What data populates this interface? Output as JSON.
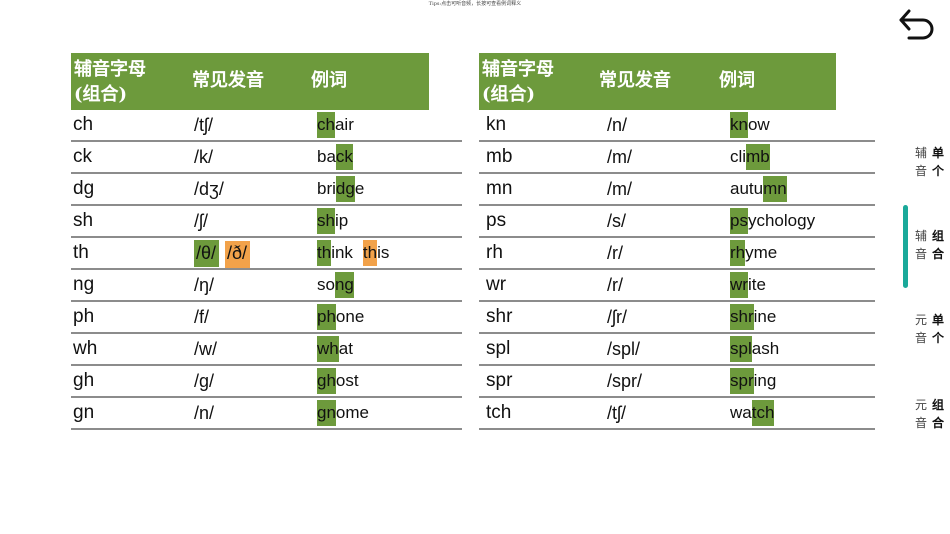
{
  "tip": "Tips:点击可听音频，长按可查看例词释义",
  "back_icon": "back-arrow-icon",
  "left_table": {
    "headers": [
      "辅音字母\n(组合)",
      "常见发音",
      "例词"
    ],
    "rows": [
      {
        "letters": "ch",
        "sounds": [
          {
            "text": "/tʃ/",
            "hl": ""
          }
        ],
        "examples": [
          {
            "parts": [
              {
                "t": "ch",
                "hl": "g"
              },
              {
                "t": "air",
                "hl": ""
              }
            ]
          }
        ]
      },
      {
        "letters": "ck",
        "sounds": [
          {
            "text": "/k/",
            "hl": ""
          }
        ],
        "examples": [
          {
            "parts": [
              {
                "t": "ba",
                "hl": ""
              },
              {
                "t": "ck",
                "hl": "g"
              }
            ]
          }
        ]
      },
      {
        "letters": "dg",
        "sounds": [
          {
            "text": "/dʒ/",
            "hl": ""
          }
        ],
        "examples": [
          {
            "parts": [
              {
                "t": "bri",
                "hl": ""
              },
              {
                "t": "dg",
                "hl": "g"
              },
              {
                "t": "e",
                "hl": ""
              }
            ]
          }
        ]
      },
      {
        "letters": "sh",
        "sounds": [
          {
            "text": "/ʃ/",
            "hl": ""
          }
        ],
        "examples": [
          {
            "parts": [
              {
                "t": "sh",
                "hl": "g"
              },
              {
                "t": "ip",
                "hl": ""
              }
            ]
          }
        ]
      },
      {
        "letters": "th",
        "sounds": [
          {
            "text": "/θ/",
            "hl": "g"
          },
          {
            "text": "/ð/",
            "hl": "o"
          }
        ],
        "examples": [
          {
            "parts": [
              {
                "t": "th",
                "hl": "g"
              },
              {
                "t": "ink",
                "hl": ""
              }
            ]
          },
          {
            "parts": [
              {
                "t": "th",
                "hl": "o"
              },
              {
                "t": "is",
                "hl": ""
              }
            ]
          }
        ]
      },
      {
        "letters": "ng",
        "sounds": [
          {
            "text": "/ŋ/",
            "hl": ""
          }
        ],
        "examples": [
          {
            "parts": [
              {
                "t": "so",
                "hl": ""
              },
              {
                "t": "ng",
                "hl": "g"
              }
            ]
          }
        ]
      },
      {
        "letters": "ph",
        "sounds": [
          {
            "text": "/f/",
            "hl": ""
          }
        ],
        "examples": [
          {
            "parts": [
              {
                "t": "ph",
                "hl": "g"
              },
              {
                "t": "one",
                "hl": ""
              }
            ]
          }
        ]
      },
      {
        "letters": "wh",
        "sounds": [
          {
            "text": "/w/",
            "hl": ""
          }
        ],
        "examples": [
          {
            "parts": [
              {
                "t": "wh",
                "hl": "g"
              },
              {
                "t": "at",
                "hl": ""
              }
            ]
          }
        ]
      },
      {
        "letters": "gh",
        "sounds": [
          {
            "text": "/g/",
            "hl": ""
          }
        ],
        "examples": [
          {
            "parts": [
              {
                "t": "gh",
                "hl": "g"
              },
              {
                "t": "ost",
                "hl": ""
              }
            ]
          }
        ]
      },
      {
        "letters": "gn",
        "sounds": [
          {
            "text": "/n/",
            "hl": ""
          }
        ],
        "examples": [
          {
            "parts": [
              {
                "t": "gn",
                "hl": "g"
              },
              {
                "t": "ome",
                "hl": ""
              }
            ]
          }
        ]
      }
    ]
  },
  "right_table": {
    "headers": [
      "辅音字母\n(组合)",
      "常见发音",
      "例词"
    ],
    "rows": [
      {
        "letters": "kn",
        "sounds": [
          {
            "text": "/n/",
            "hl": ""
          }
        ],
        "examples": [
          {
            "parts": [
              {
                "t": "kn",
                "hl": "g"
              },
              {
                "t": "ow",
                "hl": ""
              }
            ]
          }
        ]
      },
      {
        "letters": "mb",
        "sounds": [
          {
            "text": "/m/",
            "hl": ""
          }
        ],
        "examples": [
          {
            "parts": [
              {
                "t": "cli",
                "hl": ""
              },
              {
                "t": "mb",
                "hl": "g"
              }
            ]
          }
        ]
      },
      {
        "letters": "mn",
        "sounds": [
          {
            "text": "/m/",
            "hl": ""
          }
        ],
        "examples": [
          {
            "parts": [
              {
                "t": "autu",
                "hl": ""
              },
              {
                "t": "mn",
                "hl": "g"
              }
            ]
          }
        ]
      },
      {
        "letters": "ps",
        "sounds": [
          {
            "text": "/s/",
            "hl": ""
          }
        ],
        "examples": [
          {
            "parts": [
              {
                "t": "ps",
                "hl": "g"
              },
              {
                "t": "ychology",
                "hl": ""
              }
            ]
          }
        ]
      },
      {
        "letters": "rh",
        "sounds": [
          {
            "text": "/r/",
            "hl": ""
          }
        ],
        "examples": [
          {
            "parts": [
              {
                "t": "rh",
                "hl": "g"
              },
              {
                "t": "yme",
                "hl": ""
              }
            ]
          }
        ]
      },
      {
        "letters": "wr",
        "sounds": [
          {
            "text": "/r/",
            "hl": ""
          }
        ],
        "examples": [
          {
            "parts": [
              {
                "t": "wr",
                "hl": "g"
              },
              {
                "t": "ite",
                "hl": ""
              }
            ]
          }
        ]
      },
      {
        "letters": "shr",
        "sounds": [
          {
            "text": "/ʃr/",
            "hl": ""
          }
        ],
        "examples": [
          {
            "parts": [
              {
                "t": "shr",
                "hl": "g"
              },
              {
                "t": "ine",
                "hl": ""
              }
            ]
          }
        ]
      },
      {
        "letters": "spl",
        "sounds": [
          {
            "text": "/spl/",
            "hl": ""
          }
        ],
        "examples": [
          {
            "parts": [
              {
                "t": "spl",
                "hl": "g"
              },
              {
                "t": "ash",
                "hl": ""
              }
            ]
          }
        ]
      },
      {
        "letters": "spr",
        "sounds": [
          {
            "text": "/spr/",
            "hl": ""
          }
        ],
        "examples": [
          {
            "parts": [
              {
                "t": "spr",
                "hl": "g"
              },
              {
                "t": "ing",
                "hl": ""
              }
            ]
          }
        ]
      },
      {
        "letters": "tch",
        "sounds": [
          {
            "text": "/tʃ/",
            "hl": ""
          }
        ],
        "examples": [
          {
            "parts": [
              {
                "t": "wa",
                "hl": ""
              },
              {
                "t": "tch",
                "hl": "g"
              }
            ]
          }
        ]
      }
    ]
  },
  "side_nav": [
    {
      "line1_left": "辅",
      "line2_left": "音",
      "line1_right": "单",
      "line2_right": "个",
      "active": false
    },
    {
      "line1_left": "辅",
      "line2_left": "音",
      "line1_right": "组",
      "line2_right": "合",
      "active": true
    },
    {
      "line1_left": "元",
      "line2_left": "音",
      "line1_right": "单",
      "line2_right": "个",
      "active": false
    },
    {
      "line1_left": "元",
      "line2_left": "音",
      "line1_right": "组",
      "line2_right": "合",
      "active": false
    }
  ],
  "colors": {
    "header_green": "#6d9a3c",
    "highlight_green": "#6d9a3c",
    "highlight_orange": "#f2a24a",
    "active_bar": "#1aa99a"
  }
}
